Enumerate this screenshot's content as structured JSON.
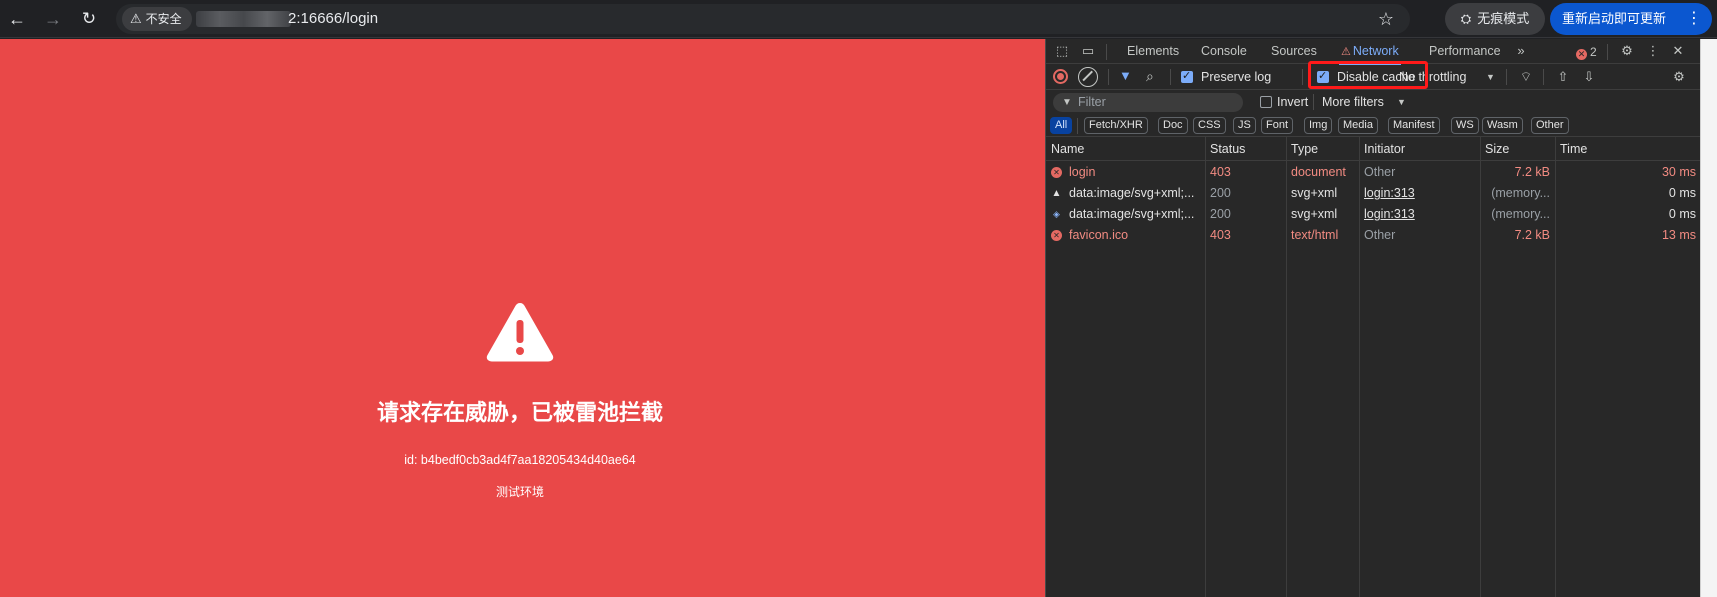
{
  "browser": {
    "security_label": "不安全",
    "url_suffix": "2:16666/login",
    "incognito_label": "无痕模式",
    "update_label": "重新启动即可更新"
  },
  "page": {
    "title": "请求存在威胁，已被雷池拦截",
    "request_id": "id: b4bedf0cb3ad4f7aa18205434d40ae64",
    "env_label": "测试环境",
    "background_color": "#e94848"
  },
  "devtools": {
    "tabs": [
      "Elements",
      "Console",
      "Sources",
      "Network",
      "Performance"
    ],
    "active_tab": "Network",
    "error_count": "2",
    "toolbar": {
      "preserve_log": "Preserve log",
      "disable_cache": "Disable cache",
      "throttling": "No throttling"
    },
    "filter": {
      "placeholder": "Filter",
      "invert": "Invert",
      "more_filters": "More filters"
    },
    "type_filters": [
      "All",
      "Fetch/XHR",
      "Doc",
      "CSS",
      "JS",
      "Font",
      "Img",
      "Media",
      "Manifest",
      "WS",
      "Wasm",
      "Other"
    ],
    "columns": [
      "Name",
      "Status",
      "Type",
      "Initiator",
      "Size",
      "Time"
    ],
    "rows": [
      {
        "name": "login",
        "status": "403",
        "type": "document",
        "initiator": "Other",
        "size": "7.2 kB",
        "time": "30 ms",
        "icon": "error-icon"
      },
      {
        "name": "data:image/svg+xml;...",
        "status": "200",
        "type": "svg+xml",
        "initiator": "login:313",
        "size": "(memory...",
        "time": "0 ms",
        "icon": "warning-triangle-icon"
      },
      {
        "name": "data:image/svg+xml;...",
        "status": "200",
        "type": "svg+xml",
        "initiator": "login:313",
        "size": "(memory...",
        "time": "0 ms",
        "icon": "shield-icon"
      },
      {
        "name": "favicon.ico",
        "status": "403",
        "type": "text/html",
        "initiator": "Other",
        "size": "7.2 kB",
        "time": "13 ms",
        "icon": "error-icon"
      }
    ],
    "colors": {
      "error_text": "#f28b82",
      "accent": "#7cacf8",
      "highlight": "#ff1a1a"
    }
  }
}
